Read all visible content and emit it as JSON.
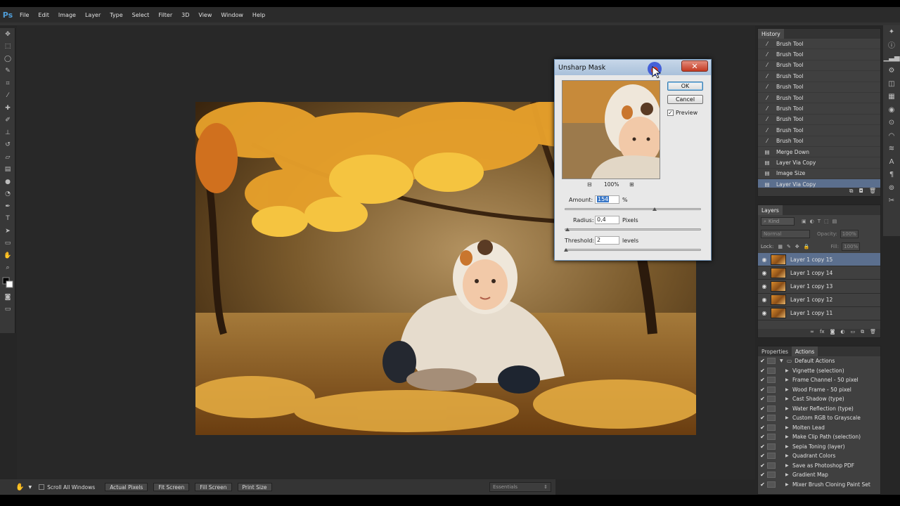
{
  "app": {
    "logo": "Ps"
  },
  "menu": [
    "File",
    "Edit",
    "Image",
    "Layer",
    "Type",
    "Select",
    "Filter",
    "3D",
    "View",
    "Window",
    "Help"
  ],
  "tools": [
    "move-tool-icon",
    "marquee-icon",
    "lasso-icon",
    "quick-select-icon",
    "crop-icon",
    "eyedropper-icon",
    "healing-icon",
    "brush-icon",
    "stamp-icon",
    "history-brush-icon",
    "eraser-icon",
    "gradient-icon",
    "blur-icon",
    "dodge-icon",
    "pen-icon",
    "type-icon",
    "path-select-icon",
    "shape-icon",
    "hand-icon",
    "zoom-icon"
  ],
  "dialog": {
    "title": "Unsharp Mask",
    "close": "✕",
    "ok": "OK",
    "cancel": "Cancel",
    "preview_label": "Preview",
    "preview_checked": true,
    "zoom": "100%",
    "amount_label": "Amount:",
    "amount_value": "154",
    "amount_unit": "%",
    "amount_slider": 0.66,
    "radius_label": "Radius:",
    "radius_value": "0,4",
    "radius_unit": "Pixels",
    "radius_slider": 0.02,
    "threshold_label": "Threshold:",
    "threshold_value": "2",
    "threshold_unit": "levels",
    "threshold_slider": 0.01
  },
  "history": {
    "tab": "History",
    "items": [
      {
        "label": "Brush Tool",
        "icon": "brush-icon"
      },
      {
        "label": "Brush Tool",
        "icon": "brush-icon"
      },
      {
        "label": "Brush Tool",
        "icon": "brush-icon"
      },
      {
        "label": "Brush Tool",
        "icon": "brush-icon"
      },
      {
        "label": "Brush Tool",
        "icon": "brush-icon"
      },
      {
        "label": "Brush Tool",
        "icon": "brush-icon"
      },
      {
        "label": "Brush Tool",
        "icon": "brush-icon"
      },
      {
        "label": "Brush Tool",
        "icon": "brush-icon"
      },
      {
        "label": "Brush Tool",
        "icon": "brush-icon"
      },
      {
        "label": "Brush Tool",
        "icon": "brush-icon"
      },
      {
        "label": "Merge Down",
        "icon": "layer-icon"
      },
      {
        "label": "Layer Via Copy",
        "icon": "layer-icon"
      },
      {
        "label": "Image Size",
        "icon": "layer-icon"
      },
      {
        "label": "Layer Via Copy",
        "icon": "layer-icon",
        "selected": true
      }
    ]
  },
  "layers": {
    "tab": "Layers",
    "kind": "Kind",
    "blend": "Normal",
    "opacity_label": "Opacity:",
    "opacity": "100%",
    "lock_label": "Lock:",
    "fill_label": "Fill:",
    "fill": "100%",
    "items": [
      {
        "label": "Layer 1 copy 15",
        "selected": true
      },
      {
        "label": "Layer 1 copy 14"
      },
      {
        "label": "Layer 1 copy 13"
      },
      {
        "label": "Layer 1 copy 12"
      },
      {
        "label": "Layer 1 copy 11"
      }
    ]
  },
  "actions": {
    "tabs": [
      "Properties",
      "Actions"
    ],
    "set": "Default Actions",
    "items": [
      "Vignette (selection)",
      "Frame Channel - 50 pixel",
      "Wood Frame - 50 pixel",
      "Cast Shadow (type)",
      "Water Reflection (type)",
      "Custom RGB to Grayscale",
      "Molten Lead",
      "Make Clip Path (selection)",
      "Sepia Toning (layer)",
      "Quadrant Colors",
      "Save as Photoshop PDF",
      "Gradient Map",
      "Mixer Brush Cloning Paint Set"
    ]
  },
  "bottombar": {
    "scroll_all": "Scroll All Windows",
    "actual": "Actual Pixels",
    "fit": "Fit Screen",
    "fill": "Fill Screen",
    "print": "Print Size",
    "workspace": "Essentials"
  }
}
